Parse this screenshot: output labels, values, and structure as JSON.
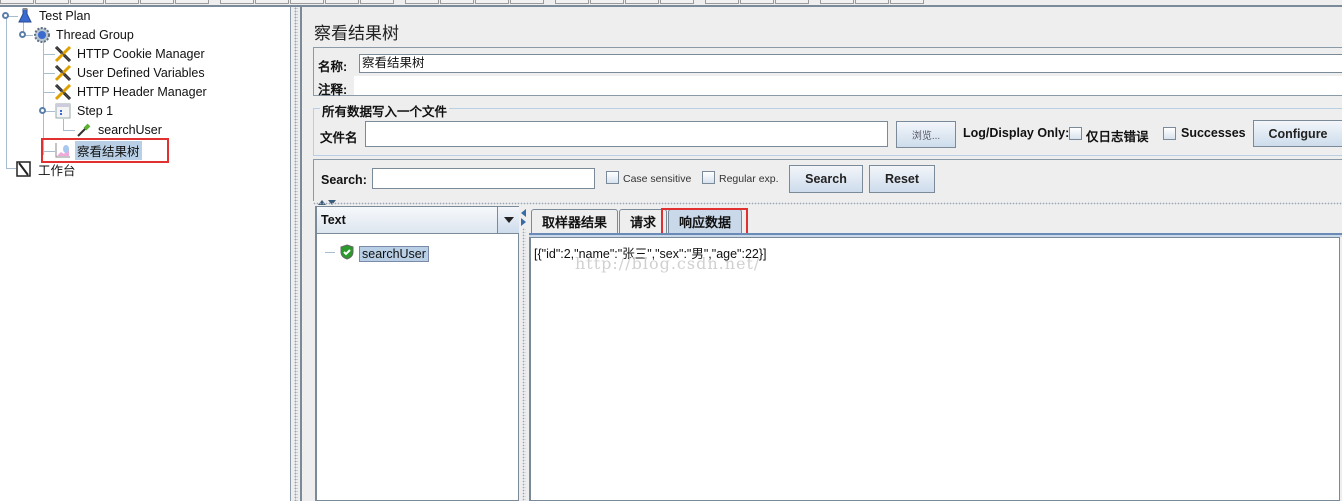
{
  "tree": {
    "items": [
      {
        "label": "Test Plan",
        "icon": "test-plan-flask-icon"
      },
      {
        "label": "Thread Group",
        "icon": "thread-group-gear-icon"
      },
      {
        "label": "HTTP Cookie Manager",
        "icon": "config-tools-icon"
      },
      {
        "label": "User Defined Variables",
        "icon": "config-tools-icon"
      },
      {
        "label": "HTTP Header Manager",
        "icon": "config-tools-icon"
      },
      {
        "label": "Step 1",
        "icon": "controller-icon"
      },
      {
        "label": "searchUser",
        "icon": "sampler-pipette-icon"
      },
      {
        "label": "察看结果树",
        "icon": "listener-graph-icon",
        "selected": true
      },
      {
        "label": "工作台",
        "icon": "workbench-icon"
      }
    ]
  },
  "panel": {
    "title": "察看结果树",
    "name_label": "名称:",
    "name_value": "察看结果树",
    "comment_label": "注释:",
    "comment_value": ""
  },
  "file_group": {
    "title": "所有数据写入一个文件",
    "filename_label": "文件名",
    "filename_value": "",
    "browse_label": "浏览...",
    "log_display_label": "Log/Display Only:",
    "errors_only_label": "仅日志错误",
    "errors_only_checked": false,
    "successes_label": "Successes",
    "successes_checked": false,
    "configure_label": "Configure"
  },
  "search": {
    "label": "Search:",
    "value": "",
    "case_sensitive_label": "Case sensitive",
    "case_sensitive_checked": false,
    "regex_label": "Regular exp.",
    "regex_checked": false,
    "search_button": "Search",
    "reset_button": "Reset"
  },
  "results": {
    "renderer_selected": "Text",
    "items": [
      {
        "label": "searchUser",
        "status": "success"
      }
    ]
  },
  "tabs": [
    {
      "label": "取样器结果",
      "active": false
    },
    {
      "label": "请求",
      "active": false
    },
    {
      "label": "响应数据",
      "active": true
    }
  ],
  "response": {
    "text": "[{\"id\":2,\"name\":\"张三\",\"sex\":\"男\",\"age\":22}]",
    "watermark": "http://blog.csdn.net/"
  },
  "highlights": {
    "color": "#e03030"
  }
}
